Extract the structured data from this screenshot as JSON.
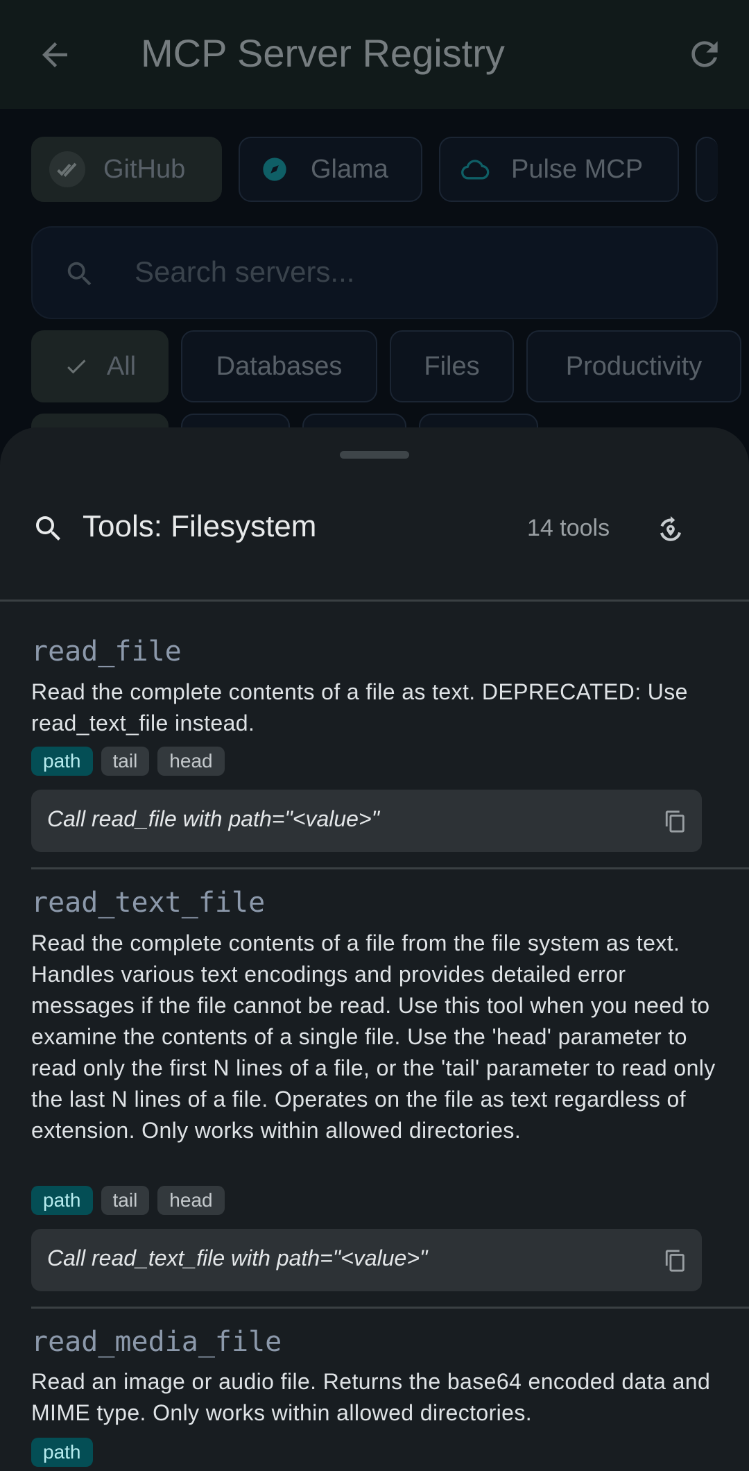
{
  "app": {
    "title": "MCP Server Registry"
  },
  "sources": [
    {
      "label": "GitHub",
      "icon": "double-check-icon",
      "selected": true
    },
    {
      "label": "Glama",
      "icon": "compass-icon",
      "selected": false
    },
    {
      "label": "Pulse MCP",
      "icon": "cloud-icon",
      "selected": false
    }
  ],
  "search": {
    "placeholder": "Search servers..."
  },
  "categories": [
    {
      "label": "All",
      "selected": true
    },
    {
      "label": "Databases",
      "selected": false
    },
    {
      "label": "Files",
      "selected": false
    },
    {
      "label": "Productivity",
      "selected": false
    }
  ],
  "sheet": {
    "title": "Tools: Filesystem",
    "count": "14 tools",
    "tools": [
      {
        "name": "read_file",
        "description": "Read the complete contents of a file as text. DEPRECATED: Use read_text_file instead.",
        "params": [
          {
            "label": "path",
            "required": true
          },
          {
            "label": "tail",
            "required": false
          },
          {
            "label": "head",
            "required": false
          }
        ],
        "call": "Call read_file with path=\"<value>\""
      },
      {
        "name": "read_text_file",
        "description": "Read the complete contents of a file from the file system as text. Handles various text encodings and provides detailed error messages if the file cannot be read. Use this tool when you need to examine the contents of a single file. Use the 'head' parameter to read only the first N lines of a file, or the 'tail' parameter to read only the last N lines of a file. Operates on the file as text regardless of extension. Only works within allowed directories.",
        "params": [
          {
            "label": "path",
            "required": true
          },
          {
            "label": "tail",
            "required": false
          },
          {
            "label": "head",
            "required": false
          }
        ],
        "call": "Call read_text_file with path=\"<value>\""
      },
      {
        "name": "read_media_file",
        "description": "Read an image or audio file. Returns the base64 encoded data and MIME type. Only works within allowed directories.",
        "params": [
          {
            "label": "path",
            "required": true
          }
        ]
      }
    ]
  },
  "colors": {
    "accent": "#23a9b3",
    "required_tag_bg": "#044e55",
    "sheet_bg": "#181d21",
    "tool_name": "#8c99ab"
  }
}
